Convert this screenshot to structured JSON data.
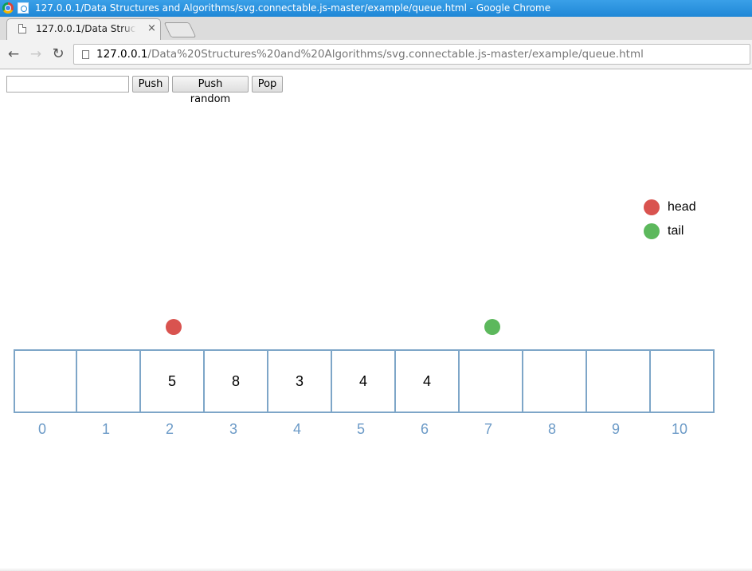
{
  "window": {
    "title": "127.0.0.1/Data Structures and Algorithms/svg.connectable.js-master/example/queue.html - Google Chrome"
  },
  "tab": {
    "title": "127.0.0.1/Data Structur",
    "close": "×"
  },
  "toolbar": {
    "back_icon": "arrow-left-icon",
    "forward_icon": "arrow-right-icon",
    "reload_icon": "reload-icon",
    "url_host": "127.0.0.1",
    "url_path": "/Data%20Structures%20and%20Algorithms/svg.connectable.js-master/example/queue.html"
  },
  "controls": {
    "input_value": "",
    "push_label": "Push",
    "push_random_label": "Push random",
    "pop_label": "Pop"
  },
  "legend": [
    {
      "label": "head",
      "color": "#d9534f"
    },
    {
      "label": "tail",
      "color": "#5cb85c"
    }
  ],
  "queue": {
    "cells": [
      "",
      "",
      "5",
      "8",
      "3",
      "4",
      "4",
      "",
      "",
      "",
      ""
    ],
    "indices": [
      "0",
      "1",
      "2",
      "3",
      "4",
      "5",
      "6",
      "7",
      "8",
      "9",
      "10"
    ],
    "head_index": 2,
    "tail_index": 7,
    "head_color": "#d9534f",
    "tail_color": "#5cb85c",
    "border_color": "#7ea6c8",
    "index_color": "#6b9ac7"
  }
}
